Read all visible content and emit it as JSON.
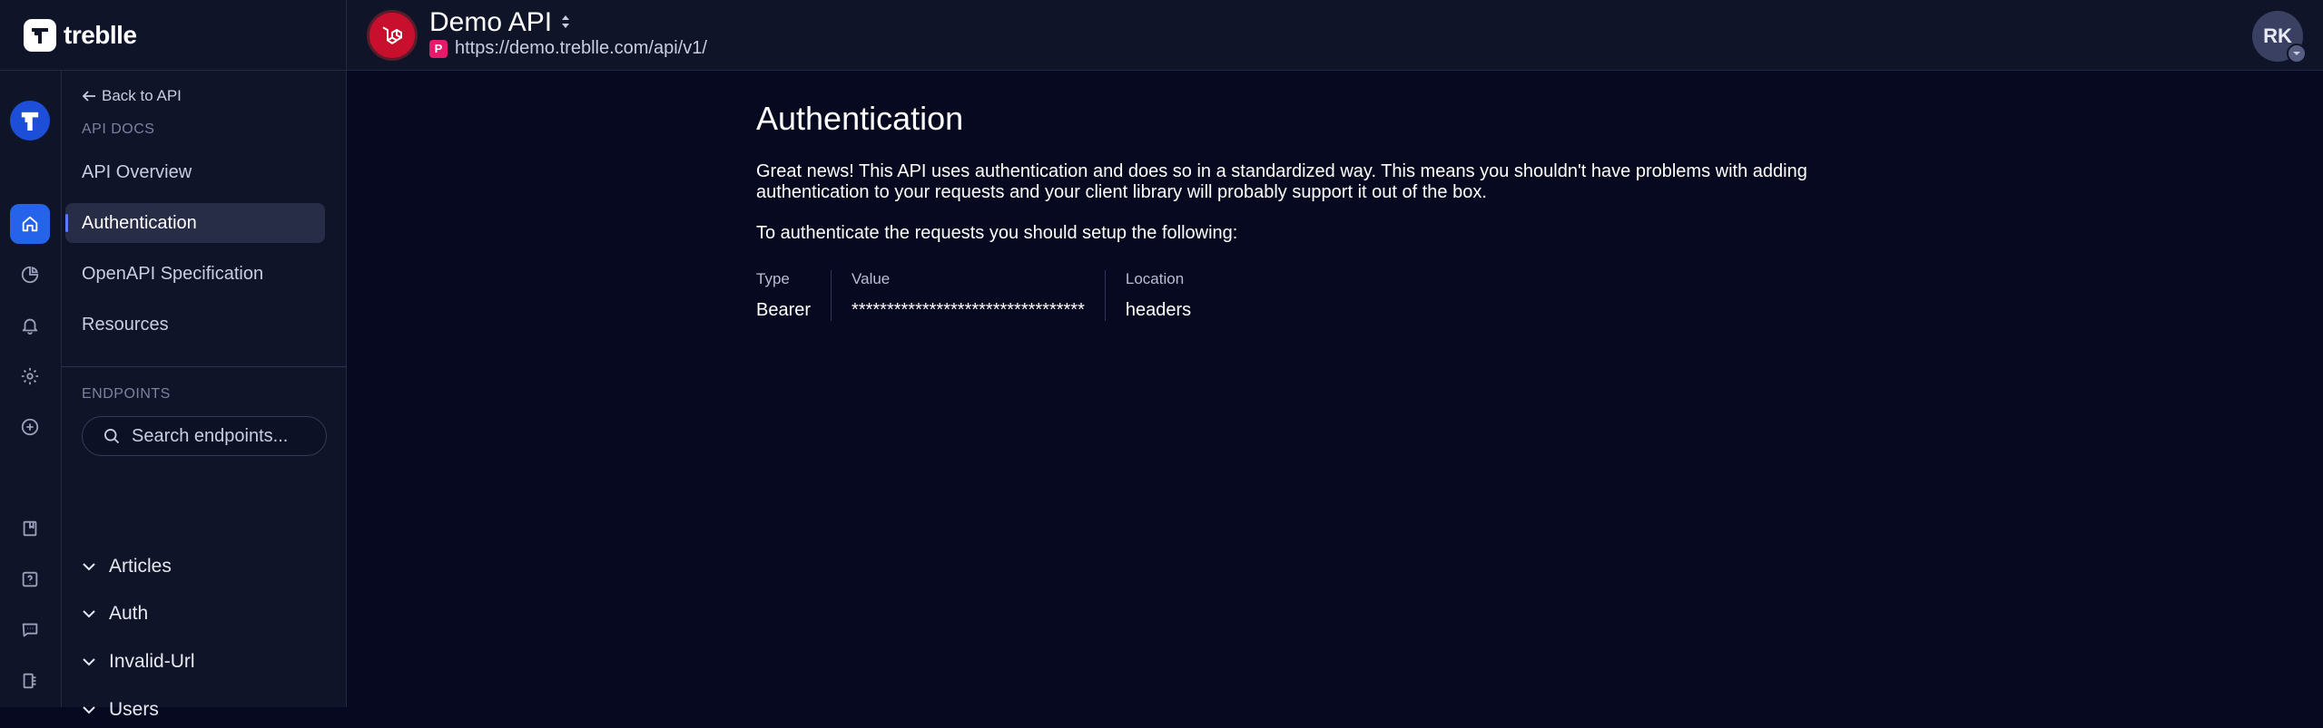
{
  "brand": {
    "name": "treblle"
  },
  "header": {
    "api_name": "Demo API",
    "env_badge": "P",
    "api_url": "https://demo.treblle.com/api/v1/",
    "user_initials": "RK"
  },
  "rail": {
    "items": [
      "treblle-home",
      "home",
      "overview",
      "alerts",
      "settings",
      "add",
      "docs",
      "help",
      "chat",
      "apps"
    ],
    "accent_color": "#2563eb"
  },
  "nav": {
    "back_label": "Back to API",
    "docs_section_label": "API DOCS",
    "docs_items": [
      {
        "label": "API Overview",
        "active": false
      },
      {
        "label": "Authentication",
        "active": true
      },
      {
        "label": "OpenAPI Specification",
        "active": false
      },
      {
        "label": "Resources",
        "active": false
      }
    ],
    "endpoints_section_label": "ENDPOINTS",
    "search_placeholder": "Search endpoints...",
    "endpoint_groups": [
      "Articles",
      "Auth",
      "Invalid-Url",
      "Users"
    ]
  },
  "main": {
    "title": "Authentication",
    "description": "Great news! This API uses authentication and does so in a standardized way. This means you shouldn't have problems with adding authentication to your requests and your client library will probably support it out of the box.",
    "setup_text": "To authenticate the requests you should setup the following:",
    "auth": {
      "type_label": "Type",
      "type_value": "Bearer",
      "value_label": "Value",
      "value_value": "*********************************",
      "location_label": "Location",
      "location_value": "headers"
    }
  },
  "colors": {
    "background": "#070920",
    "panel": "#101428",
    "laravel_red": "#c8102e",
    "prod_badge": "#e6196b"
  }
}
